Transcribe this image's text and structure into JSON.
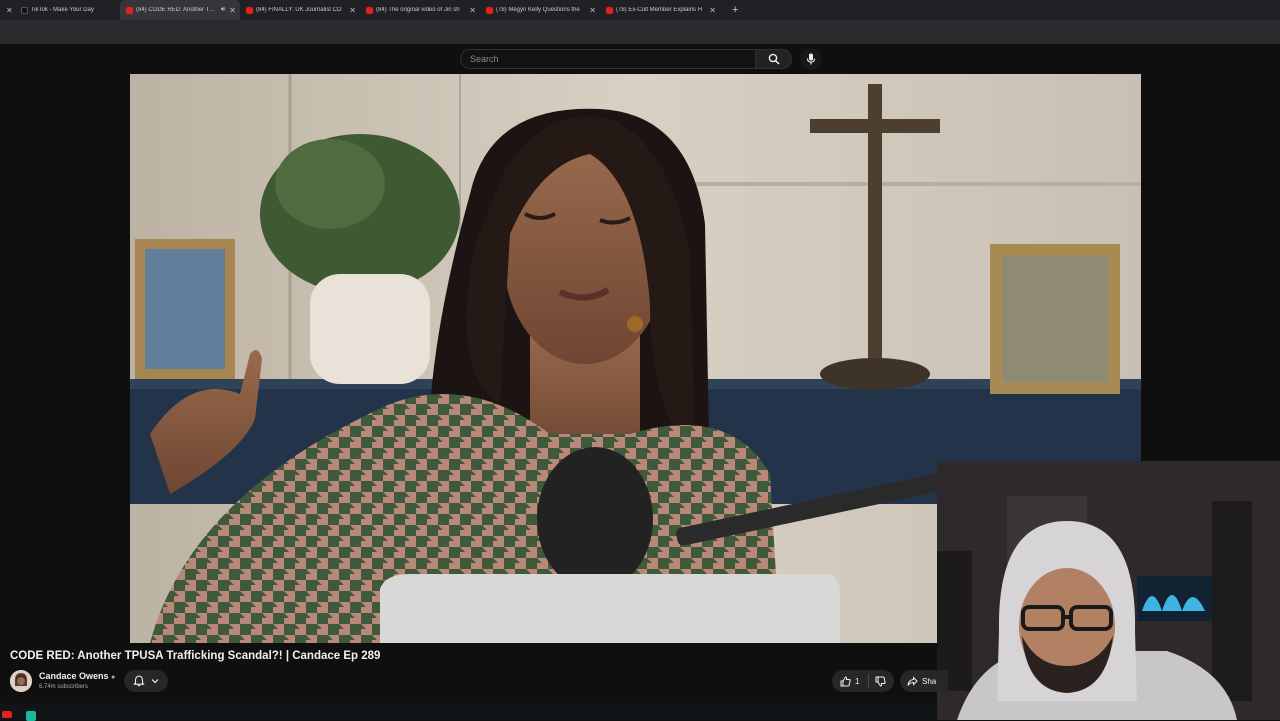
{
  "tabs": [
    {
      "label": "TikTok - Make Your Day",
      "favicon": "tiktok-icon",
      "active": false
    },
    {
      "label": "(84) CODE RED: Another TPUSA",
      "favicon": "youtube-icon",
      "active": true,
      "audio": true
    },
    {
      "label": "(84) FINALLY: UK Journalist CO",
      "favicon": "youtube-icon",
      "active": false
    },
    {
      "label": "(84) The original video of Jin sh",
      "favicon": "youtube-icon",
      "active": false
    },
    {
      "label": "(78) Megyn Kelly Questions the",
      "favicon": "youtube-icon",
      "active": false
    },
    {
      "label": "(78) Ex-Cult Member Explains H",
      "favicon": "youtube-icon",
      "active": false
    }
  ],
  "header": {
    "search_placeholder": "Search"
  },
  "video": {
    "title": "CODE RED: Another TPUSA Trafficking Scandal?! | Candace Ep 289",
    "channel": "Candace Owens",
    "subscribers": "6.74m subscribers",
    "likes": "1",
    "share_label": "Sha"
  },
  "colors": {
    "background": "#0f0f0f",
    "tabbar": "#202124",
    "accent_red": "#e62117",
    "button_bg": "#272727"
  }
}
